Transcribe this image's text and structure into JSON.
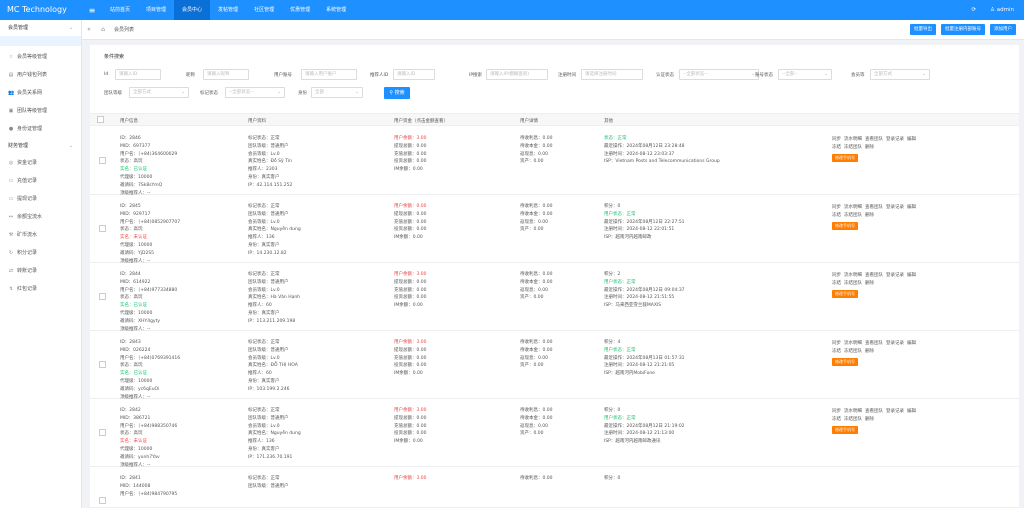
{
  "app": {
    "brand": "MC Technology",
    "user": "admin"
  },
  "topnav": [
    "站前首页",
    "项目管理",
    "会员中心",
    "发帖管理",
    "社区管理",
    "优惠管理",
    "系统管理"
  ],
  "sidebar": {
    "group1": "会员管理",
    "items": [
      {
        "icon": "star-icon",
        "glyph": "☆",
        "label": "会员等级管理"
      },
      {
        "icon": "list-icon",
        "glyph": "▤",
        "label": "用户钱包列表"
      },
      {
        "icon": "users-icon",
        "glyph": "👥",
        "label": "会员关系网"
      },
      {
        "icon": "team-icon",
        "glyph": "▣",
        "label": "团队等级管理"
      },
      {
        "icon": "dot-icon",
        "glyph": "●",
        "label": "身份证管理"
      }
    ],
    "group2": "财务管理",
    "items2": [
      {
        "icon": "cash-icon",
        "glyph": "◎",
        "label": "资金记录"
      },
      {
        "icon": "recharge-icon",
        "glyph": "▭",
        "label": "充值记录"
      },
      {
        "icon": "withdraw-icon",
        "glyph": "▭",
        "label": "提现记录"
      },
      {
        "icon": "yuebao-icon",
        "glyph": "↔",
        "label": "余额宝流水"
      },
      {
        "icon": "mining-icon",
        "glyph": "⚒",
        "label": "矿币流水"
      },
      {
        "icon": "points-icon",
        "glyph": "↻",
        "label": "积分记录"
      },
      {
        "icon": "swap-icon",
        "glyph": "⇄",
        "label": "转账记录"
      },
      {
        "icon": "redpack-icon",
        "glyph": "↯",
        "label": "红包记录"
      }
    ]
  },
  "tabs": {
    "current": "会员列表",
    "actions": [
      "批量导出",
      "批量注册内部账号",
      "添加用户"
    ]
  },
  "search": {
    "title": "条件搜索",
    "search_label": "搜索",
    "filters": [
      {
        "label": "Id",
        "placeholder": "请输入ID"
      },
      {
        "label": "昵称",
        "placeholder": "请输入昵称"
      },
      {
        "label": "用户账号",
        "placeholder": "请输入用户账户"
      },
      {
        "label": "推荐人ID",
        "placeholder": "请输入ID"
      },
      {
        "label": "IP搜索",
        "placeholder": "请输入IP(模糊查询)"
      },
      {
        "label": "注册时间",
        "placeholder": "请选择注册时间"
      },
      {
        "label": "认证状态",
        "placeholder": "--全部状态--"
      },
      {
        "label": "账号状态",
        "placeholder": "--全部--"
      },
      {
        "label": "会员等",
        "placeholder": "全部方式"
      },
      {
        "label": "团队等级",
        "placeholder": "全部方式"
      },
      {
        "label": "标记状态",
        "placeholder": "--全部状态--"
      },
      {
        "label": "身份",
        "placeholder": "全部"
      }
    ]
  },
  "table": {
    "headers": [
      "用户信息",
      "用户资料",
      "用户资金（点击金额查看）",
      "用户详情",
      "其他",
      "操作"
    ],
    "op_labels": [
      "同步",
      "流水明细",
      "查看团队",
      "登录记录",
      "编辑",
      "冻结",
      "冻结团队",
      "删除"
    ],
    "op_button": "修改手机号",
    "rows": [
      {
        "info": [
          "ID：2846",
          "MID：697377",
          "用户名：（+84)364600029",
          "状态：高玩",
          "实名：已认证",
          "代理级：10000",
          "邀请码：7Sk8sYmQ",
          "顶级推荐人：--"
        ],
        "profile": [
          "标记状态：正常",
          "团队等级：普通用户",
          "会员等级：Lv.0",
          "真实姓名：Đỗ Sỹ Tín",
          "推荐人：2303",
          "身份：真实客户",
          "IP：42.114.151.252"
        ],
        "funds": [
          "用户余额：3.00",
          "提现总额：0.00",
          "充值总额：0.00",
          "投资总额：0.00",
          "IM余额：0.00"
        ],
        "detail": [
          "待收利息：0.00",
          "待收本金：0.00",
          "返现息：0.00",
          "资产：0.00"
        ],
        "other": [
          "状态：正常",
          "最近操作：2024年08月12日 23:28:48",
          "注册时间：2024-08-12 23:03:37",
          "ISP：Vietnam Posts and Telecommunications Group"
        ]
      },
      {
        "info": [
          "ID：2845",
          "MID：929717",
          "用户名：（+84)0852907707",
          "状态：高玩",
          "实名：未认证",
          "代理级：10000",
          "邀请码：YjD2S5",
          "顶级推荐人：--"
        ],
        "profile": [
          "标记状态：正常",
          "团队等级：普通用户",
          "会员等级：Lv.0",
          "真实姓名：Nguyễn dung",
          "推荐人：136",
          "身份：真实客户",
          "IP：14.230.12.82"
        ],
        "funds": [
          "用户余额：0.00",
          "提现总额：0.00",
          "充值总额：0.00",
          "投资总额：0.00",
          "IM余额：0.00"
        ],
        "detail": [
          "待收利息：0.00",
          "待收本金：0.00",
          "返现息：0.00",
          "资产：0.00"
        ],
        "other": [
          "积分：0",
          "用户状态：正常",
          "最近操作：2024年08月12日 22:27:51",
          "注册时间：2024-08-12 22:01:51",
          "ISP：越南河内越南邮政"
        ]
      },
      {
        "info": [
          "ID：2844",
          "MID：614922",
          "用户名：（+84)977334880",
          "状态：高玩",
          "实名：已认证",
          "代理级：10000",
          "邀请码：XHY4gyty",
          "顶级推荐人：--"
        ],
        "profile": [
          "标记状态：正常",
          "团队等级：普通用户",
          "会员等级：Lv.0",
          "真实姓名：Hà Văn Hạnh",
          "推荐人：60",
          "身份：真实客户",
          "IP：113.211.209.198"
        ],
        "funds": [
          "用户余额：3.00",
          "提现总额：0.00",
          "充值总额：0.00",
          "投资总额：0.00",
          "IM余额：0.00"
        ],
        "detail": [
          "待收利息：0.00",
          "待收本金：0.00",
          "返现息：0.00",
          "资产：0.00"
        ],
        "other": [
          "积分：2",
          "用户状态：正常",
          "最近操作：2024年08月12日 09:04:37",
          "注册时间：2024-08-12 21:51:55",
          "ISP：马来西亚雪兰莪MAXIS"
        ]
      },
      {
        "info": [
          "ID：2843",
          "MID：026224",
          "用户名：（+84)0769391416",
          "状态：高玩",
          "实名：已认证",
          "代理级：10000",
          "邀请码：yc6qEuOi",
          "顶级推荐人：--"
        ],
        "profile": [
          "标记状态：正常",
          "团队等级：普通用户",
          "会员等级：Lv.0",
          "真实姓名：ĐỖ THỊ HOA",
          "推荐人：60",
          "身份：真实客户",
          "IP：103.199.2.246"
        ],
        "funds": [
          "用户余额：3.00",
          "提现总额：0.00",
          "充值总额：0.00",
          "投资总额：0.00",
          "IM余额：0.00"
        ],
        "detail": [
          "待收利息：0.00",
          "待收本金：0.00",
          "返现息：0.00",
          "资产：0.00"
        ],
        "other": [
          "积分：4",
          "用户状态：正常",
          "最近操作：2024年08月13日 01:57:31",
          "注册时间：2024-08-12 21:21:05",
          "ISP：越南河内MobiFone"
        ]
      },
      {
        "info": [
          "ID：2842",
          "MID：386721",
          "用户名：（+84)988350746",
          "状态：高玩",
          "实名：未认证",
          "代理级：10000",
          "邀请码：yunh7Yav",
          "顶级推荐人：--"
        ],
        "profile": [
          "标记状态：正常",
          "团队等级：普通用户",
          "会员等级：Lv.0",
          "真实姓名：Nguyễn dung",
          "推荐人：136",
          "身份：真实客户",
          "IP：171.236.70.191"
        ],
        "funds": [
          "用户余额：3.00",
          "提现总额：0.00",
          "充值总额：0.00",
          "投资总额：0.00",
          "IM余额：0.00"
        ],
        "detail": [
          "待收利息：0.00",
          "待收本金：0.00",
          "返现息：0.00",
          "资产：0.00"
        ],
        "other": [
          "积分：0",
          "用户状态：正常",
          "最近操作：2024年08月12日 21:19:02",
          "注册时间：2024-08-12 21:13:00",
          "ISP：越南河内越南邮政通讯"
        ]
      },
      {
        "info": [
          "ID：2841",
          "MID：144008",
          "用户名：（+84)984790795"
        ],
        "profile": [
          "标记状态：正常",
          "团队等级：普通用户"
        ],
        "funds": [
          "用户余额：3.00"
        ],
        "detail": [
          "待收利息：0.00"
        ],
        "other": [
          "积分：0"
        ]
      }
    ]
  },
  "watermark": "执福商业源码www.myppp.top",
  "colors": {
    "primary": "#1e90ff",
    "active_nav": "#0a6fd6",
    "danger": "#e54848",
    "success": "#19be6b",
    "warn_btn": "#ff7d00"
  }
}
